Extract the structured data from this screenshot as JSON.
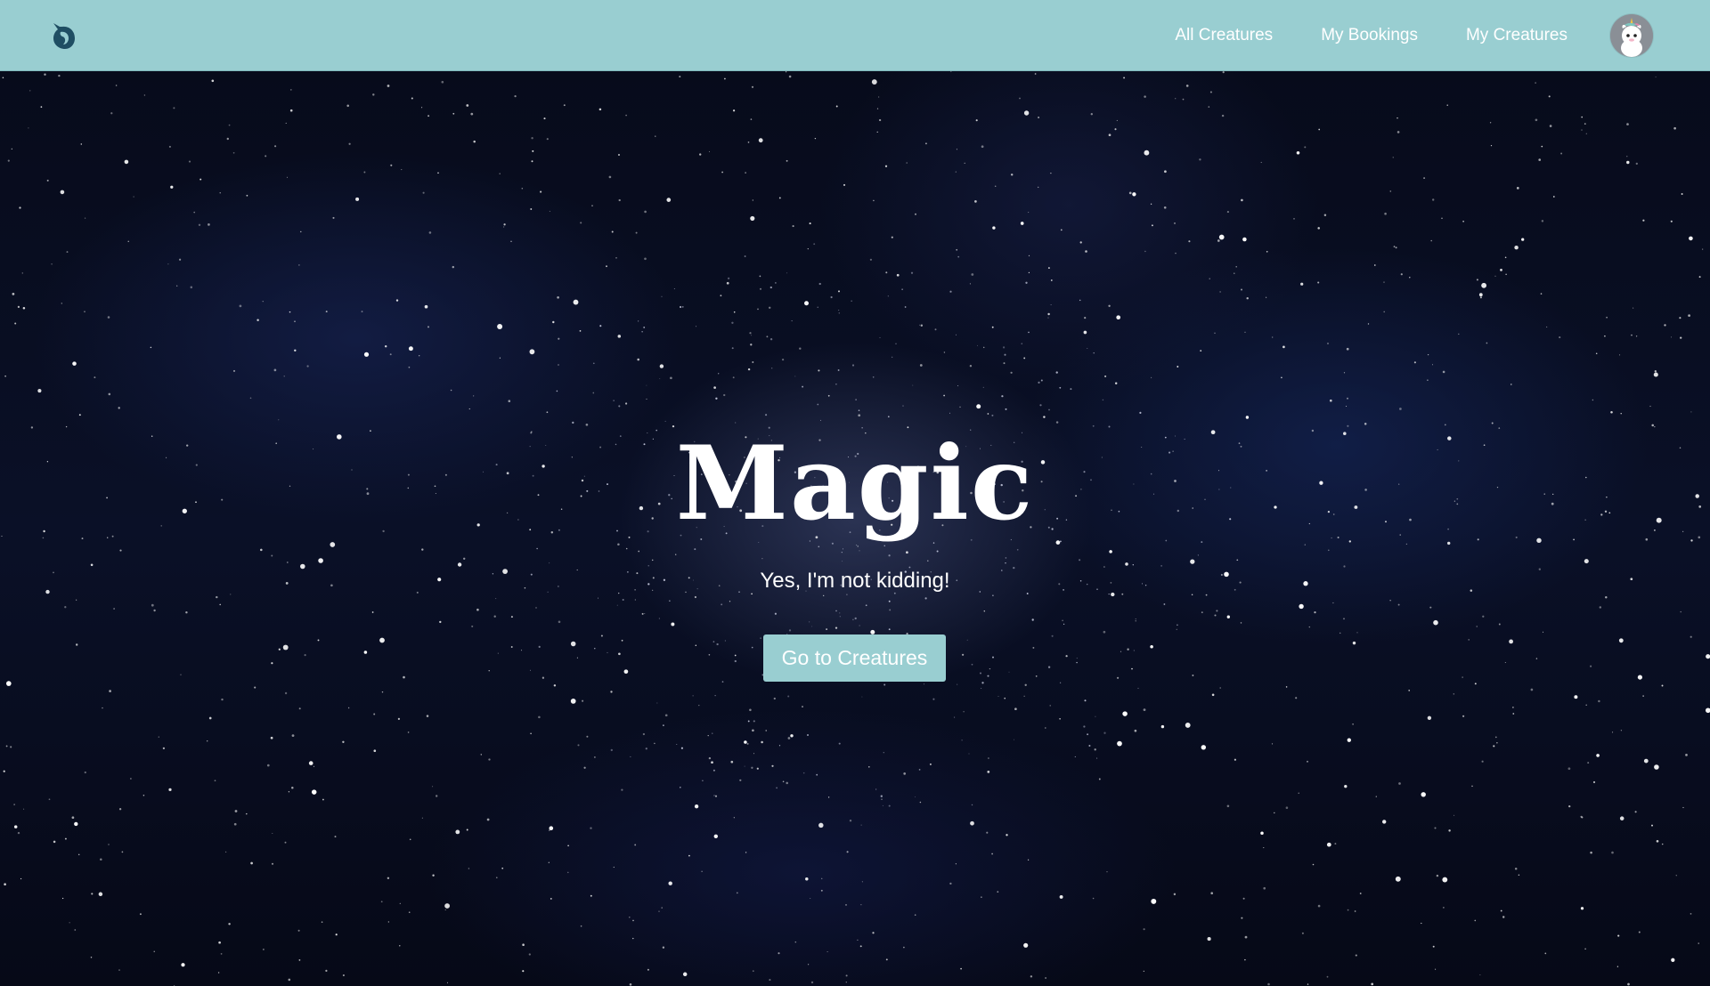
{
  "navbar": {
    "logo_icon": "unicorn-head-icon",
    "links": [
      {
        "label": "All Creatures"
      },
      {
        "label": "My Bookings"
      },
      {
        "label": "My Creatures"
      }
    ],
    "avatar_icon": "unicorn-avatar-icon",
    "background_color": "#99ced1"
  },
  "hero": {
    "title": "Magic",
    "subtitle": "Yes, I'm not kidding!",
    "cta_label": "Go to Creatures",
    "background": "starry-night-sky",
    "cta_color": "#99ced1"
  }
}
